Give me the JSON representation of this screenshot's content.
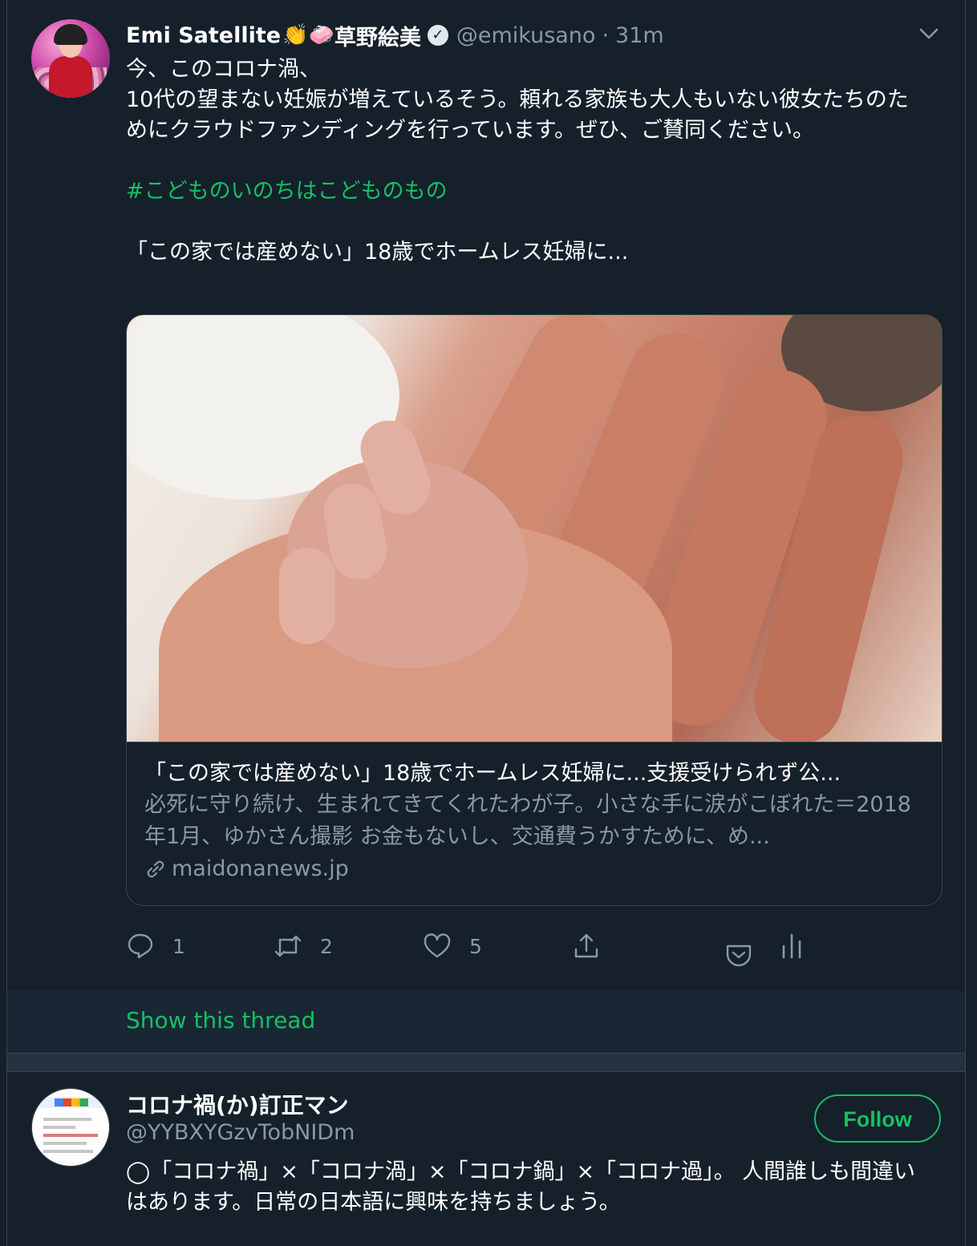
{
  "tweet": {
    "author_name": "Emi Satellite",
    "author_emoji": "👏🧼",
    "author_name_jp": "草野絵美",
    "verified_mark": "✓",
    "handle": "@emikusano",
    "separator": "·",
    "time": "31m",
    "text_lines": [
      "今、このコロナ渦、",
      "10代の望まない妊娠が増えているそう。頼れる家族も大人もいない彼女たちのためにクラウドファンディングを行っています。ぜひ、ご賛同ください。"
    ],
    "hashtag": "#こどものいのちはこどものもの",
    "link_title_text": "「この家では産めない」18歳でホームレス妊婦に...",
    "card": {
      "title": "「この家では産めない」18歳でホームレス妊婦に...支援受けられず公...",
      "description": "必死に守り続け、生まれてきてくれたわが子。小さな手に涙がこぼれた＝2018年1月、ゆかさん撮影 お金もないし、交通費うかすために、め...",
      "domain": "maidonanews.jp"
    },
    "actions": {
      "reply_count": "1",
      "retweet_count": "2",
      "like_count": "5"
    }
  },
  "thread_link": "Show this thread",
  "reply": {
    "name": "コロナ禍(か)訂正マン",
    "handle": "@YYBXYGzvTobNIDm",
    "follow_label": "Follow",
    "text": "◯「コロナ禍」×「コロナ渦」×「コロナ鍋」×「コロナ過」。 人間誰しも間違いはあります。日常の日本語に興味を持ちましょう。"
  },
  "colors": {
    "background": "#15202b",
    "accent": "#17bf63",
    "muted": "#8899a6",
    "border": "#38444d"
  },
  "icons": [
    "chevron-down-icon",
    "verified-icon",
    "link-icon",
    "reply-icon",
    "retweet-icon",
    "like-icon",
    "share-icon",
    "pocket-icon",
    "analytics-icon"
  ]
}
